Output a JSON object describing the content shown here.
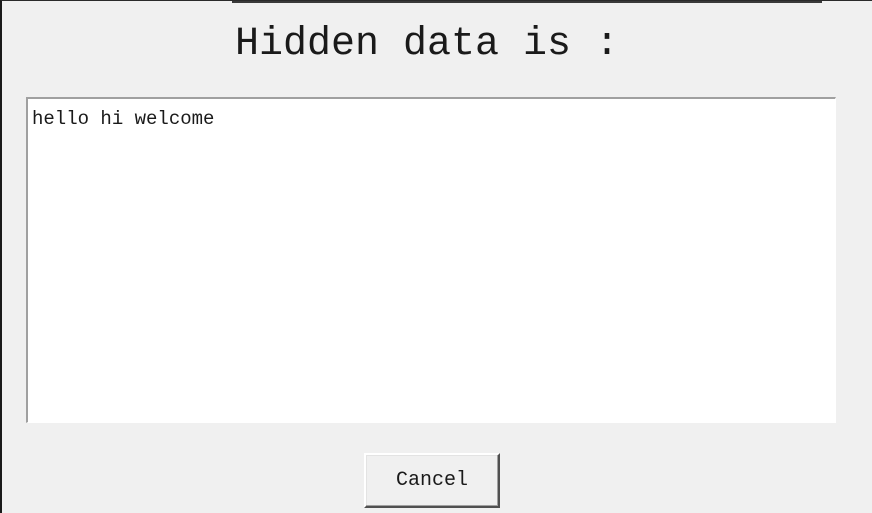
{
  "dialog": {
    "title": "Hidden data is :",
    "hidden_text": "hello hi welcome",
    "cancel_label": "Cancel"
  }
}
